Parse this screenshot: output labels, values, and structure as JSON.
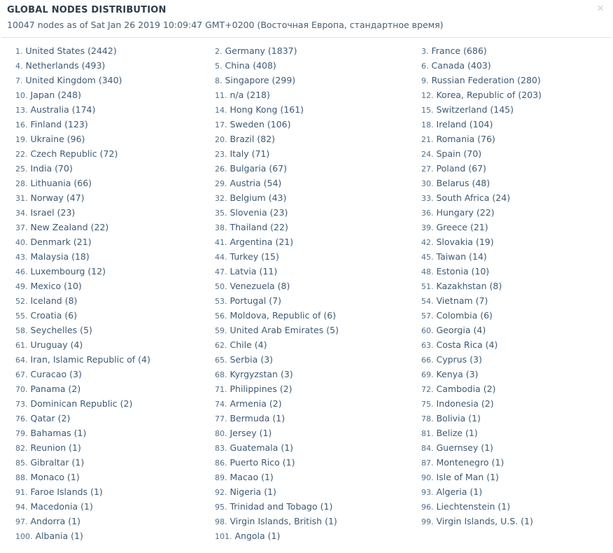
{
  "header": {
    "title": "GLOBAL NODES DISTRIBUTION",
    "subtitle": "10047 nodes as of Sat Jan 26 2019 10:09:47 GMT+0200 (Восточная Европа, стандартное время)",
    "close_label": "×"
  },
  "colors": {
    "text": "#3d5a73",
    "title": "#2e3d49",
    "divider": "#e3e3e3",
    "close": "#cfcfcf",
    "background": "#ffffff"
  },
  "nodes": [
    {
      "rank": "1.",
      "country": "United States",
      "count": "(2442)"
    },
    {
      "rank": "2.",
      "country": "Germany",
      "count": "(1837)"
    },
    {
      "rank": "3.",
      "country": "France",
      "count": "(686)"
    },
    {
      "rank": "4.",
      "country": "Netherlands",
      "count": "(493)"
    },
    {
      "rank": "5.",
      "country": "China",
      "count": "(408)"
    },
    {
      "rank": "6.",
      "country": "Canada",
      "count": "(403)"
    },
    {
      "rank": "7.",
      "country": "United Kingdom",
      "count": "(340)"
    },
    {
      "rank": "8.",
      "country": "Singapore",
      "count": "(299)"
    },
    {
      "rank": "9.",
      "country": "Russian Federation",
      "count": "(280)"
    },
    {
      "rank": "10.",
      "country": "Japan",
      "count": "(248)"
    },
    {
      "rank": "11.",
      "country": "n/a",
      "count": "(218)"
    },
    {
      "rank": "12.",
      "country": "Korea, Republic of",
      "count": "(203)"
    },
    {
      "rank": "13.",
      "country": "Australia",
      "count": "(174)"
    },
    {
      "rank": "14.",
      "country": "Hong Kong",
      "count": "(161)"
    },
    {
      "rank": "15.",
      "country": "Switzerland",
      "count": "(145)"
    },
    {
      "rank": "16.",
      "country": "Finland",
      "count": "(123)"
    },
    {
      "rank": "17.",
      "country": "Sweden",
      "count": "(106)"
    },
    {
      "rank": "18.",
      "country": "Ireland",
      "count": "(104)"
    },
    {
      "rank": "19.",
      "country": "Ukraine",
      "count": "(96)"
    },
    {
      "rank": "20.",
      "country": "Brazil",
      "count": "(82)"
    },
    {
      "rank": "21.",
      "country": "Romania",
      "count": "(76)"
    },
    {
      "rank": "22.",
      "country": "Czech Republic",
      "count": "(72)"
    },
    {
      "rank": "23.",
      "country": "Italy",
      "count": "(71)"
    },
    {
      "rank": "24.",
      "country": "Spain",
      "count": "(70)"
    },
    {
      "rank": "25.",
      "country": "India",
      "count": "(70)"
    },
    {
      "rank": "26.",
      "country": "Bulgaria",
      "count": "(67)"
    },
    {
      "rank": "27.",
      "country": "Poland",
      "count": "(67)"
    },
    {
      "rank": "28.",
      "country": "Lithuania",
      "count": "(66)"
    },
    {
      "rank": "29.",
      "country": "Austria",
      "count": "(54)"
    },
    {
      "rank": "30.",
      "country": "Belarus",
      "count": "(48)"
    },
    {
      "rank": "31.",
      "country": "Norway",
      "count": "(47)"
    },
    {
      "rank": "32.",
      "country": "Belgium",
      "count": "(43)"
    },
    {
      "rank": "33.",
      "country": "South Africa",
      "count": "(24)"
    },
    {
      "rank": "34.",
      "country": "Israel",
      "count": "(23)"
    },
    {
      "rank": "35.",
      "country": "Slovenia",
      "count": "(23)"
    },
    {
      "rank": "36.",
      "country": "Hungary",
      "count": "(22)"
    },
    {
      "rank": "37.",
      "country": "New Zealand",
      "count": "(22)"
    },
    {
      "rank": "38.",
      "country": "Thailand",
      "count": "(22)"
    },
    {
      "rank": "39.",
      "country": "Greece",
      "count": "(21)"
    },
    {
      "rank": "40.",
      "country": "Denmark",
      "count": "(21)"
    },
    {
      "rank": "41.",
      "country": "Argentina",
      "count": "(21)"
    },
    {
      "rank": "42.",
      "country": "Slovakia",
      "count": "(19)"
    },
    {
      "rank": "43.",
      "country": "Malaysia",
      "count": "(18)"
    },
    {
      "rank": "44.",
      "country": "Turkey",
      "count": "(15)"
    },
    {
      "rank": "45.",
      "country": "Taiwan",
      "count": "(14)"
    },
    {
      "rank": "46.",
      "country": "Luxembourg",
      "count": "(12)"
    },
    {
      "rank": "47.",
      "country": "Latvia",
      "count": "(11)"
    },
    {
      "rank": "48.",
      "country": "Estonia",
      "count": "(10)"
    },
    {
      "rank": "49.",
      "country": "Mexico",
      "count": "(10)"
    },
    {
      "rank": "50.",
      "country": "Venezuela",
      "count": "(8)"
    },
    {
      "rank": "51.",
      "country": "Kazakhstan",
      "count": "(8)"
    },
    {
      "rank": "52.",
      "country": "Iceland",
      "count": "(8)"
    },
    {
      "rank": "53.",
      "country": "Portugal",
      "count": "(7)"
    },
    {
      "rank": "54.",
      "country": "Vietnam",
      "count": "(7)"
    },
    {
      "rank": "55.",
      "country": "Croatia",
      "count": "(6)"
    },
    {
      "rank": "56.",
      "country": "Moldova, Republic of",
      "count": "(6)"
    },
    {
      "rank": "57.",
      "country": "Colombia",
      "count": "(6)"
    },
    {
      "rank": "58.",
      "country": "Seychelles",
      "count": "(5)"
    },
    {
      "rank": "59.",
      "country": "United Arab Emirates",
      "count": "(5)"
    },
    {
      "rank": "60.",
      "country": "Georgia",
      "count": "(4)"
    },
    {
      "rank": "61.",
      "country": "Uruguay",
      "count": "(4)"
    },
    {
      "rank": "62.",
      "country": "Chile",
      "count": "(4)"
    },
    {
      "rank": "63.",
      "country": "Costa Rica",
      "count": "(4)"
    },
    {
      "rank": "64.",
      "country": "Iran, Islamic Republic of",
      "count": "(4)"
    },
    {
      "rank": "65.",
      "country": "Serbia",
      "count": "(3)"
    },
    {
      "rank": "66.",
      "country": "Cyprus",
      "count": "(3)"
    },
    {
      "rank": "67.",
      "country": "Curacao",
      "count": "(3)"
    },
    {
      "rank": "68.",
      "country": "Kyrgyzstan",
      "count": "(3)"
    },
    {
      "rank": "69.",
      "country": "Kenya",
      "count": "(3)"
    },
    {
      "rank": "70.",
      "country": "Panama",
      "count": "(2)"
    },
    {
      "rank": "71.",
      "country": "Philippines",
      "count": "(2)"
    },
    {
      "rank": "72.",
      "country": "Cambodia",
      "count": "(2)"
    },
    {
      "rank": "73.",
      "country": "Dominican Republic",
      "count": "(2)"
    },
    {
      "rank": "74.",
      "country": "Armenia",
      "count": "(2)"
    },
    {
      "rank": "75.",
      "country": "Indonesia",
      "count": "(2)"
    },
    {
      "rank": "76.",
      "country": "Qatar",
      "count": "(2)"
    },
    {
      "rank": "77.",
      "country": "Bermuda",
      "count": "(1)"
    },
    {
      "rank": "78.",
      "country": "Bolivia",
      "count": "(1)"
    },
    {
      "rank": "79.",
      "country": "Bahamas",
      "count": "(1)"
    },
    {
      "rank": "80.",
      "country": "Jersey",
      "count": "(1)"
    },
    {
      "rank": "81.",
      "country": "Belize",
      "count": "(1)"
    },
    {
      "rank": "82.",
      "country": "Reunion",
      "count": "(1)"
    },
    {
      "rank": "83.",
      "country": "Guatemala",
      "count": "(1)"
    },
    {
      "rank": "84.",
      "country": "Guernsey",
      "count": "(1)"
    },
    {
      "rank": "85.",
      "country": "Gibraltar",
      "count": "(1)"
    },
    {
      "rank": "86.",
      "country": "Puerto Rico",
      "count": "(1)"
    },
    {
      "rank": "87.",
      "country": "Montenegro",
      "count": "(1)"
    },
    {
      "rank": "88.",
      "country": "Monaco",
      "count": "(1)"
    },
    {
      "rank": "89.",
      "country": "Macao",
      "count": "(1)"
    },
    {
      "rank": "90.",
      "country": "Isle of Man",
      "count": "(1)"
    },
    {
      "rank": "91.",
      "country": "Faroe Islands",
      "count": "(1)"
    },
    {
      "rank": "92.",
      "country": "Nigeria",
      "count": "(1)"
    },
    {
      "rank": "93.",
      "country": "Algeria",
      "count": "(1)"
    },
    {
      "rank": "94.",
      "country": "Macedonia",
      "count": "(1)"
    },
    {
      "rank": "95.",
      "country": "Trinidad and Tobago",
      "count": "(1)"
    },
    {
      "rank": "96.",
      "country": "Liechtenstein",
      "count": "(1)"
    },
    {
      "rank": "97.",
      "country": "Andorra",
      "count": "(1)"
    },
    {
      "rank": "98.",
      "country": "Virgin Islands, British",
      "count": "(1)"
    },
    {
      "rank": "99.",
      "country": "Virgin Islands, U.S.",
      "count": "(1)"
    },
    {
      "rank": "100.",
      "country": "Albania",
      "count": "(1)"
    },
    {
      "rank": "101.",
      "country": "Angola",
      "count": "(1)"
    }
  ]
}
